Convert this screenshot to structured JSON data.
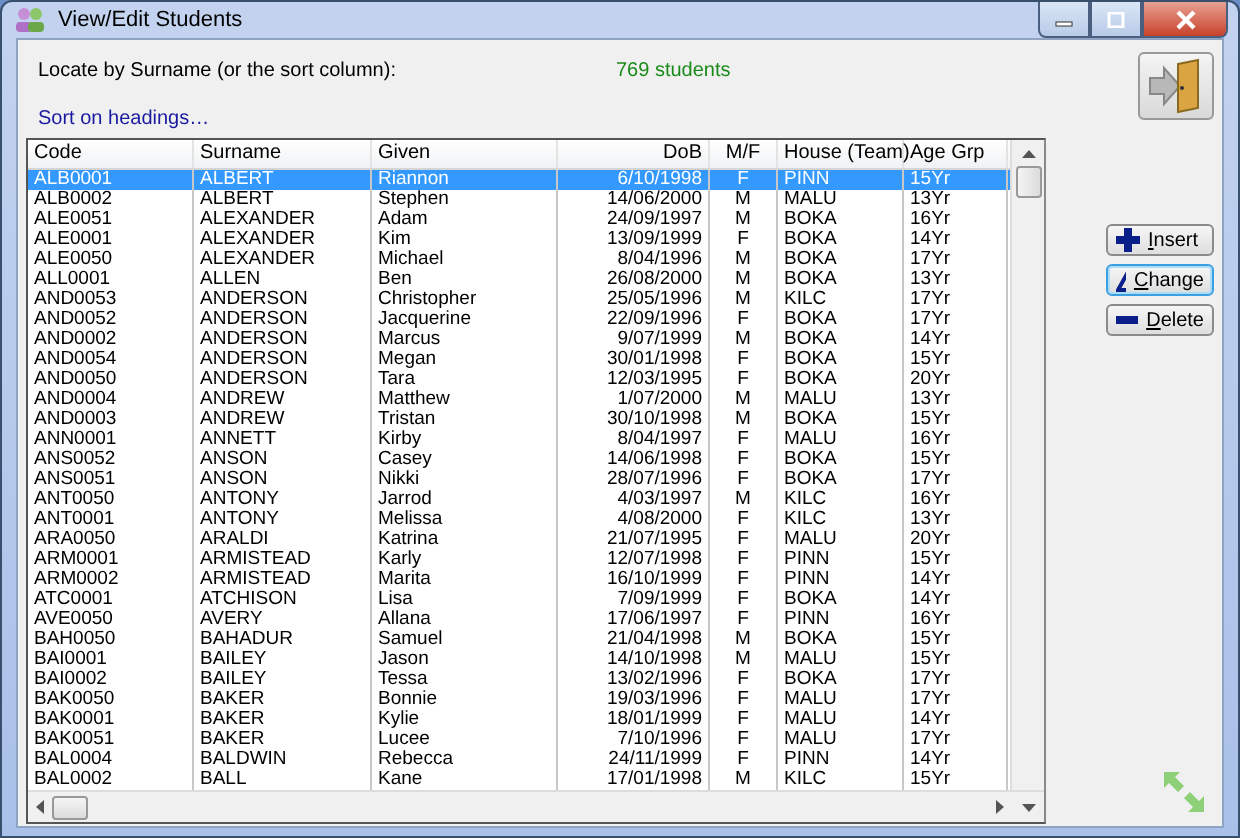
{
  "window": {
    "title": "View/Edit Students"
  },
  "locate_label": "Locate by Surname (or the sort column):",
  "student_count": "769 students",
  "sort_link": "Sort on headings…",
  "table": {
    "columns": [
      {
        "label": "Code"
      },
      {
        "label": "Surname"
      },
      {
        "label": "Given"
      },
      {
        "label": "DoB"
      },
      {
        "label": "M/F"
      },
      {
        "label": "House (Team)"
      },
      {
        "label": "Age Grp"
      }
    ],
    "rows": [
      {
        "cells": [
          "ALB0001",
          "ALBERT",
          "Riannon",
          "6/10/1998",
          "F",
          "PINN",
          "15Yr"
        ],
        "selected": true
      },
      {
        "cells": [
          "ALB0002",
          "ALBERT",
          "Stephen",
          "14/06/2000",
          "M",
          "MALU",
          "13Yr"
        ],
        "selected": false
      },
      {
        "cells": [
          "ALE0051",
          "ALEXANDER",
          "Adam",
          "24/09/1997",
          "M",
          "BOKA",
          "16Yr"
        ],
        "selected": false
      },
      {
        "cells": [
          "ALE0001",
          "ALEXANDER",
          "Kim",
          "13/09/1999",
          "F",
          "BOKA",
          "14Yr"
        ],
        "selected": false
      },
      {
        "cells": [
          "ALE0050",
          "ALEXANDER",
          "Michael",
          "8/04/1996",
          "M",
          "BOKA",
          "17Yr"
        ],
        "selected": false
      },
      {
        "cells": [
          "ALL0001",
          "ALLEN",
          "Ben",
          "26/08/2000",
          "M",
          "BOKA",
          "13Yr"
        ],
        "selected": false
      },
      {
        "cells": [
          "AND0053",
          "ANDERSON",
          "Christopher",
          "25/05/1996",
          "M",
          "KILC",
          "17Yr"
        ],
        "selected": false
      },
      {
        "cells": [
          "AND0052",
          "ANDERSON",
          "Jacquerine",
          "22/09/1996",
          "F",
          "BOKA",
          "17Yr"
        ],
        "selected": false
      },
      {
        "cells": [
          "AND0002",
          "ANDERSON",
          "Marcus",
          "9/07/1999",
          "M",
          "BOKA",
          "14Yr"
        ],
        "selected": false
      },
      {
        "cells": [
          "AND0054",
          "ANDERSON",
          "Megan",
          "30/01/1998",
          "F",
          "BOKA",
          "15Yr"
        ],
        "selected": false
      },
      {
        "cells": [
          "AND0050",
          "ANDERSON",
          "Tara",
          "12/03/1995",
          "F",
          "BOKA",
          "20Yr"
        ],
        "selected": false
      },
      {
        "cells": [
          "AND0004",
          "ANDREW",
          "Matthew",
          "1/07/2000",
          "M",
          "MALU",
          "13Yr"
        ],
        "selected": false
      },
      {
        "cells": [
          "AND0003",
          "ANDREW",
          "Tristan",
          "30/10/1998",
          "M",
          "BOKA",
          "15Yr"
        ],
        "selected": false
      },
      {
        "cells": [
          "ANN0001",
          "ANNETT",
          "Kirby",
          "8/04/1997",
          "F",
          "MALU",
          "16Yr"
        ],
        "selected": false
      },
      {
        "cells": [
          "ANS0052",
          "ANSON",
          "Casey",
          "14/06/1998",
          "F",
          "BOKA",
          "15Yr"
        ],
        "selected": false
      },
      {
        "cells": [
          "ANS0051",
          "ANSON",
          "Nikki",
          "28/07/1996",
          "F",
          "BOKA",
          "17Yr"
        ],
        "selected": false
      },
      {
        "cells": [
          "ANT0050",
          "ANTONY",
          "Jarrod",
          "4/03/1997",
          "M",
          "KILC",
          "16Yr"
        ],
        "selected": false
      },
      {
        "cells": [
          "ANT0001",
          "ANTONY",
          "Melissa",
          "4/08/2000",
          "F",
          "KILC",
          "13Yr"
        ],
        "selected": false
      },
      {
        "cells": [
          "ARA0050",
          "ARALDI",
          "Katrina",
          "21/07/1995",
          "F",
          "MALU",
          "20Yr"
        ],
        "selected": false
      },
      {
        "cells": [
          "ARM0001",
          "ARMISTEAD",
          "Karly",
          "12/07/1998",
          "F",
          "PINN",
          "15Yr"
        ],
        "selected": false
      },
      {
        "cells": [
          "ARM0002",
          "ARMISTEAD",
          "Marita",
          "16/10/1999",
          "F",
          "PINN",
          "14Yr"
        ],
        "selected": false
      },
      {
        "cells": [
          "ATC0001",
          "ATCHISON",
          "Lisa",
          "7/09/1999",
          "F",
          "BOKA",
          "14Yr"
        ],
        "selected": false
      },
      {
        "cells": [
          "AVE0050",
          "AVERY",
          "Allana",
          "17/06/1997",
          "F",
          "PINN",
          "16Yr"
        ],
        "selected": false
      },
      {
        "cells": [
          "BAH0050",
          "BAHADUR",
          "Samuel",
          "21/04/1998",
          "M",
          "BOKA",
          "15Yr"
        ],
        "selected": false
      },
      {
        "cells": [
          "BAI0001",
          "BAILEY",
          "Jason",
          "14/10/1998",
          "M",
          "MALU",
          "15Yr"
        ],
        "selected": false
      },
      {
        "cells": [
          "BAI0002",
          "BAILEY",
          "Tessa",
          "13/02/1996",
          "F",
          "BOKA",
          "17Yr"
        ],
        "selected": false
      },
      {
        "cells": [
          "BAK0050",
          "BAKER",
          "Bonnie",
          "19/03/1996",
          "F",
          "MALU",
          "17Yr"
        ],
        "selected": false
      },
      {
        "cells": [
          "BAK0001",
          "BAKER",
          "Kylie",
          "18/01/1999",
          "F",
          "MALU",
          "14Yr"
        ],
        "selected": false
      },
      {
        "cells": [
          "BAK0051",
          "BAKER",
          "Lucee",
          "7/10/1996",
          "F",
          "MALU",
          "17Yr"
        ],
        "selected": false
      },
      {
        "cells": [
          "BAL0004",
          "BALDWIN",
          "Rebecca",
          "24/11/1999",
          "F",
          "PINN",
          "14Yr"
        ],
        "selected": false
      },
      {
        "cells": [
          "BAL0002",
          "BALL",
          "Kane",
          "17/01/1998",
          "M",
          "KILC",
          "15Yr"
        ],
        "selected": false
      }
    ]
  },
  "buttons": [
    {
      "label": "Insert",
      "kind": "insert",
      "focused": false
    },
    {
      "label": "Change",
      "kind": "change",
      "focused": true
    },
    {
      "label": "Delete",
      "kind": "delete",
      "focused": false
    }
  ]
}
